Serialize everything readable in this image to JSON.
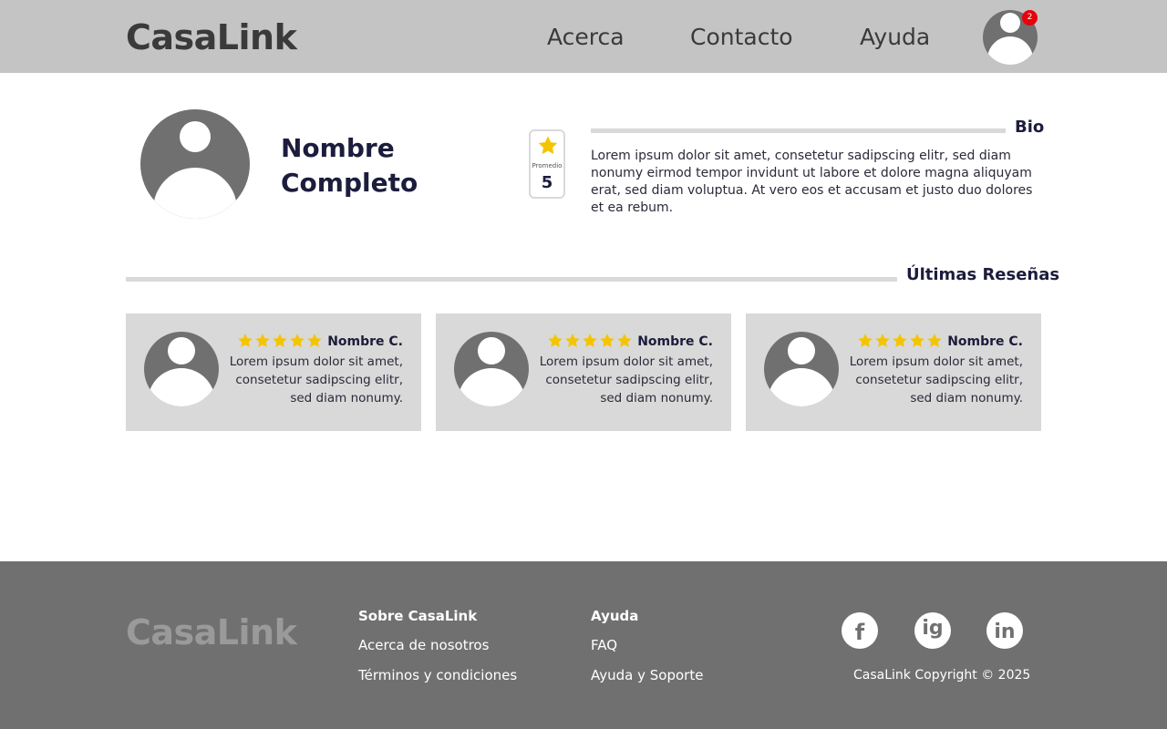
{
  "header": {
    "brand": "CasaLink",
    "nav": {
      "about": "Acerca",
      "contact": "Contacto",
      "help": "Ayuda"
    },
    "notifications_count": "2"
  },
  "profile": {
    "name": "Nombre Completo",
    "rating_caption": "Promedio",
    "rating_value": "5",
    "bio_title": "Bio",
    "bio_text": "Lorem ipsum dolor sit amet, consetetur sadipscing elitr, sed diam nonumy eirmod tempor invidunt ut labore et dolore magna aliquyam erat, sed diam voluptua. At vero eos et accusam et justo duo dolores et ea rebum."
  },
  "reviews": {
    "title": "Últimas Reseñas",
    "items": [
      {
        "name": "Nombre C.",
        "text": "Lorem ipsum dolor sit amet, consetetur sadipscing elitr, sed diam nonumy.",
        "stars": 5
      },
      {
        "name": "Nombre C.",
        "text": "Lorem ipsum dolor sit amet, consetetur sadipscing elitr, sed diam nonumy.",
        "stars": 5
      },
      {
        "name": "Nombre C.",
        "text": "Lorem ipsum dolor sit amet, consetetur sadipscing elitr, sed diam nonumy.",
        "stars": 5
      }
    ]
  },
  "footer": {
    "brand": "CasaLink",
    "about_title": "Sobre CasaLink",
    "about_links": [
      "Acerca de nosotros",
      "Términos y condiciones"
    ],
    "help_title": "Ayuda",
    "help_links": [
      "FAQ",
      "Ayuda y Soporte"
    ],
    "social": {
      "facebook": "f",
      "instagram": "ig",
      "linkedin": "in"
    },
    "copyright": "CasaLink Copyright © 2025"
  },
  "colors": {
    "header_bg": "#c4c4c4",
    "footer_bg": "#707070",
    "card_bg": "#d9d9d9",
    "star": "#f5c400",
    "badge": "#e8000a",
    "heading": "#1c1c3c"
  },
  "icons": {
    "star": "star-icon",
    "avatar": "user-avatar-icon",
    "facebook": "facebook-icon",
    "instagram": "instagram-icon",
    "linkedin": "linkedin-icon"
  }
}
